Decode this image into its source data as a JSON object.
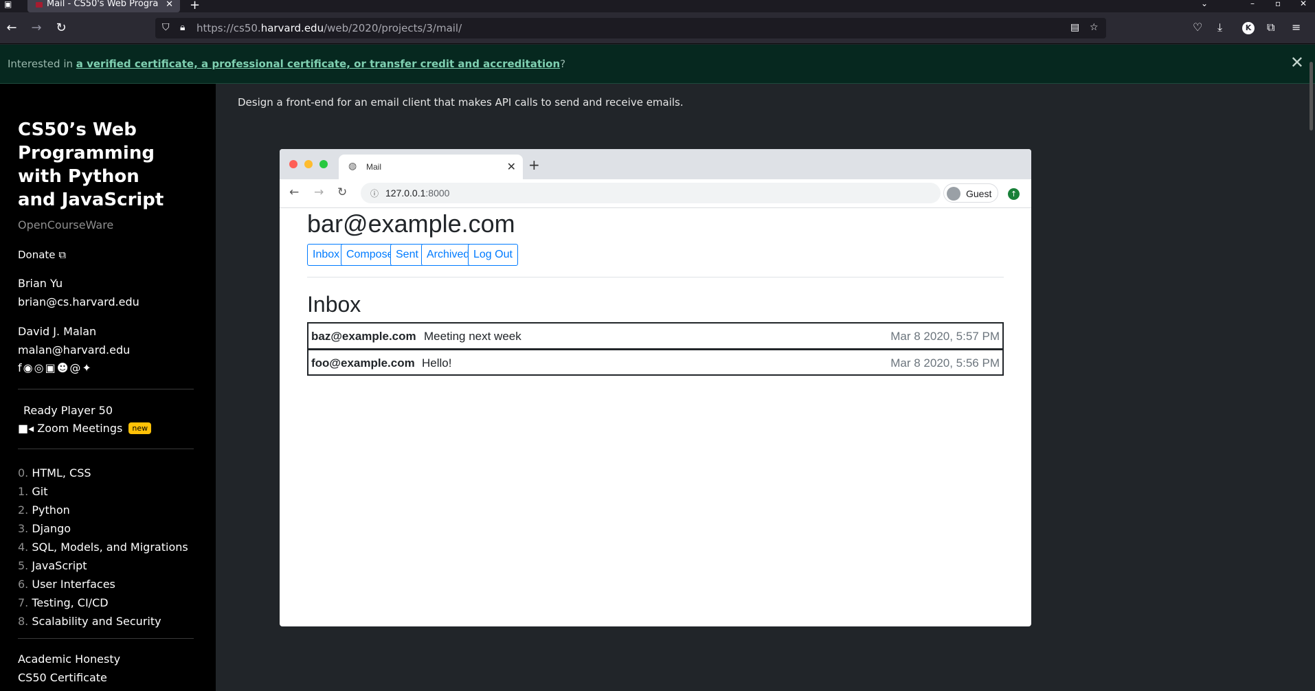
{
  "firefox": {
    "tab_title": "Mail - CS50's Web Progra",
    "url_prefix": "https://cs50.",
    "url_host": "harvard.edu",
    "url_path": "/web/2020/projects/3/mail/",
    "profile_initial": "K"
  },
  "banner": {
    "prefix": "Interested in ",
    "link_text": "a verified certificate, a professional certificate, or transfer credit and accreditation",
    "suffix": "?"
  },
  "sidebar": {
    "course_title": "CS50’s Web Programming with Python and JavaScript",
    "subtitle": "OpenCourseWare",
    "donate": "Donate",
    "instructors": [
      {
        "name": "Brian Yu",
        "email": "brian@cs.harvard.edu"
      },
      {
        "name": "David J. Malan",
        "email": "malan@harvard.edu"
      }
    ],
    "special": [
      {
        "label": "Ready Player 50"
      },
      {
        "label": "Zoom Meetings",
        "badge": "new"
      }
    ],
    "lectures": [
      {
        "num": "0.",
        "label": "HTML, CSS"
      },
      {
        "num": "1.",
        "label": "Git"
      },
      {
        "num": "2.",
        "label": "Python"
      },
      {
        "num": "3.",
        "label": "Django"
      },
      {
        "num": "4.",
        "label": "SQL, Models, and Migrations"
      },
      {
        "num": "5.",
        "label": "JavaScript"
      },
      {
        "num": "6.",
        "label": "User Interfaces"
      },
      {
        "num": "7.",
        "label": "Testing, CI/CD"
      },
      {
        "num": "8.",
        "label": "Scalability and Security"
      }
    ],
    "footer": [
      "Academic Honesty",
      "CS50 Certificate"
    ]
  },
  "main": {
    "description": "Design a front-end for an email client that makes API calls to send and receive emails."
  },
  "screenshot": {
    "tab_title": "Mail",
    "url_host": "127.0.0.1",
    "url_port": ":8000",
    "profile": "Guest",
    "user_email": "bar@example.com",
    "nav_buttons": [
      "Inbox",
      "Compose",
      "Sent",
      "Archived",
      "Log Out"
    ],
    "mailbox_title": "Inbox",
    "emails": [
      {
        "sender": "baz@example.com",
        "subject": "Meeting next week",
        "timestamp": "Mar 8 2020, 5:57 PM"
      },
      {
        "sender": "foo@example.com",
        "subject": "Hello!",
        "timestamp": "Mar 8 2020, 5:56 PM"
      }
    ]
  }
}
